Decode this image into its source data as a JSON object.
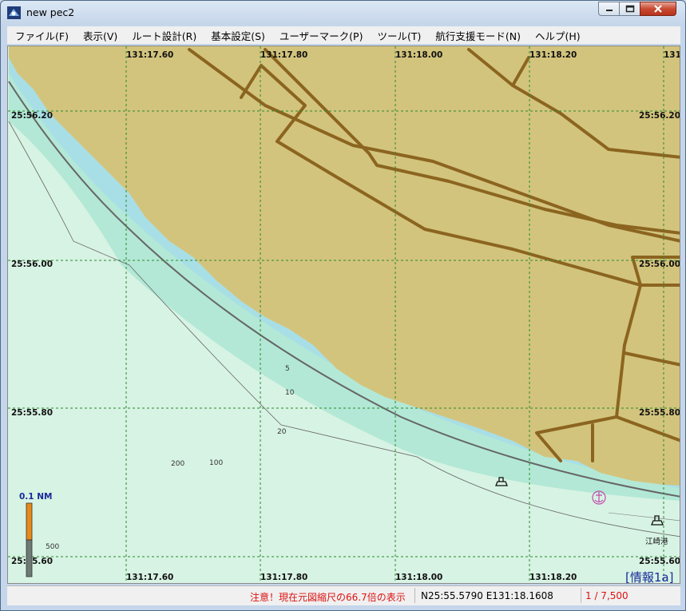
{
  "window": {
    "title": "new pec2"
  },
  "menu": [
    {
      "label": "ファイル(F)"
    },
    {
      "label": "表示(V)"
    },
    {
      "label": "ルート設計(R)"
    },
    {
      "label": "基本設定(S)"
    },
    {
      "label": "ユーザーマーク(P)"
    },
    {
      "label": "ツール(T)"
    },
    {
      "label": "航行支援モード(N)"
    },
    {
      "label": "ヘルプ(H)"
    }
  ],
  "map": {
    "longitude_top": [
      "131:17.60",
      "131:17.80",
      "131:18.00",
      "131:18.20",
      "131"
    ],
    "longitude_bottom": [
      "131:17.60",
      "131:17.80",
      "131:18.00",
      "131:18.20"
    ],
    "latitude_left": [
      "25:56.20",
      "25:56.00",
      "25:55.80",
      "25:55.60"
    ],
    "latitude_right": [
      "25:56.20",
      "25:56.00",
      "25:55.80",
      "25:55.60"
    ],
    "depth_labels": [
      "5",
      "10",
      "20",
      "200",
      "100",
      "500"
    ],
    "scale_bar_label": "0.1 NM",
    "port_label": "江崎港",
    "info_label": "[情報1a]",
    "colors": {
      "land": "#d3c47d",
      "road": "#8b6520",
      "shallow": "#a8dfe6",
      "mid": "#b3e8d6",
      "deep": "#d7f3e4"
    }
  },
  "status": {
    "warning": "注意！現在元図縮尺の66.7倍の表示",
    "coordinates": "N25:55.5790 E131:18.1608",
    "scale": "1 / 7,500"
  }
}
